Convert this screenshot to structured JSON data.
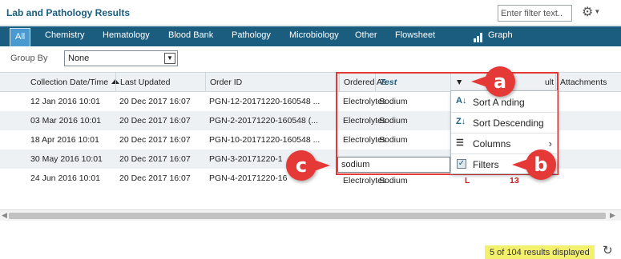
{
  "header": {
    "title": "Lab and Pathology Results",
    "filter_placeholder": "Enter filter text..",
    "gear_icon": "gear-icon"
  },
  "tabs": [
    {
      "label": "All",
      "active": true
    },
    {
      "label": "Chemistry"
    },
    {
      "label": "Hematology"
    },
    {
      "label": "Blood Bank"
    },
    {
      "label": "Pathology"
    },
    {
      "label": "Microbiology"
    },
    {
      "label": "Other"
    },
    {
      "label": "Flowsheet"
    },
    {
      "label": "Graph",
      "icon": "bar-chart-icon"
    }
  ],
  "group_by": {
    "label": "Group By",
    "value": "None"
  },
  "columns": {
    "collection_date": "Collection Date/Time",
    "last_updated": "Last Updated",
    "order_id": "Order ID",
    "ordered_as": "Ordered As",
    "test": "Test",
    "result": "ult",
    "attachments": "Attachments"
  },
  "rows": [
    {
      "collection": "12 Jan 2016 10:01",
      "updated": "20 Dec 2017 16:07",
      "order_id": "PGN-12-20171220-160548 ...",
      "ordered_as": "Electrolytes",
      "test": "Sodium",
      "flag": "",
      "result": ""
    },
    {
      "collection": "03 Mar 2016 10:01",
      "updated": "20 Dec 2017 16:07",
      "order_id": "PGN-2-20171220-160548 (...",
      "ordered_as": "Electrolytes",
      "test": "Sodium",
      "flag": "",
      "result": ""
    },
    {
      "collection": "18 Apr 2016 10:01",
      "updated": "20 Dec 2017 16:07",
      "order_id": "PGN-10-20171220-160548 ...",
      "ordered_as": "Electrolytes",
      "test": "Sodium",
      "flag": "",
      "result": ""
    },
    {
      "collection": "30 May 2016 10:01",
      "updated": "20 Dec 2017 16:07",
      "order_id": "PGN-3-20171220-1",
      "ordered_as": "",
      "test": "",
      "flag": "",
      "result": ""
    },
    {
      "collection": "24 Jun 2016 10:01",
      "updated": "20 Dec 2017 16:07",
      "order_id": "PGN-4-20171220-16",
      "ordered_as": "Electrolytes",
      "test": "Sodium",
      "flag": "L",
      "result": "13"
    }
  ],
  "column_menu": {
    "sort_ascending": "Sort A   nding",
    "sort_descending": "Sort Descending",
    "columns": "Columns",
    "filters": "Filters"
  },
  "filter_value": "sodium",
  "results_text": "5 of 104 results displayed",
  "callouts": {
    "a": "a",
    "b": "b",
    "c": "c"
  },
  "colors": {
    "brand": "#1b5d7e",
    "active_tab": "#4a9ad0",
    "callout": "#e53937",
    "badge": "#f3f06d"
  }
}
